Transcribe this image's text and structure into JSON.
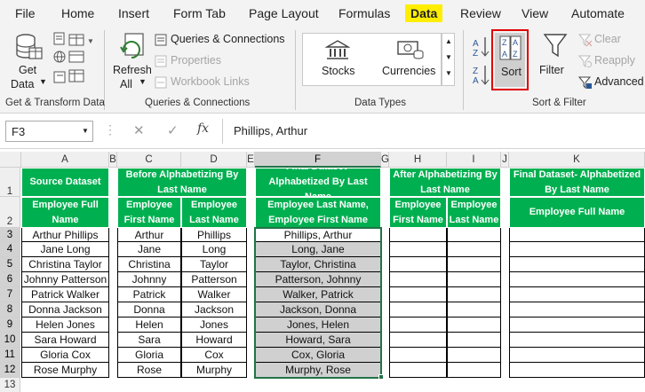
{
  "tabs": [
    "File",
    "Home",
    "Insert",
    "Form Tab",
    "Page Layout",
    "Formulas",
    "Data",
    "Review",
    "View",
    "Automate"
  ],
  "ribbon": {
    "get_data": {
      "line1": "Get",
      "line2": "Data"
    },
    "refresh": {
      "line1": "Refresh",
      "line2": "All"
    },
    "queries_connections": "Queries & Connections",
    "properties": "Properties",
    "workbook_links": "Workbook Links",
    "stocks": "Stocks",
    "currencies": "Currencies",
    "sort": "Sort",
    "filter": "Filter",
    "clear": "Clear",
    "reapply": "Reapply",
    "advanced": "Advanced",
    "groups": [
      "Get & Transform Data",
      "Queries & Connections",
      "Data Types",
      "Sort & Filter"
    ]
  },
  "formula_bar": {
    "name_box": "F3",
    "fx": "fx",
    "content": "Phillips, Arthur"
  },
  "columns": [
    "A",
    "B",
    "C",
    "D",
    "E",
    "F",
    "G",
    "H",
    "I",
    "J",
    "K"
  ],
  "rows": [
    "1",
    "2",
    "3",
    "4",
    "5",
    "6",
    "7",
    "8",
    "9",
    "10",
    "11",
    "12",
    "13"
  ],
  "headers": {
    "source": "Source Dataset",
    "before": "Before Alphabetizing By Last Name",
    "final1": "Final Dataset- Alphabetized By Last Name",
    "after": "After Alphabetizing By Last Name",
    "final2": "Final Dataset- Alphabetized By Last Name",
    "emp_full": "Employee Full Name",
    "emp_first": "Employee First Name",
    "emp_last": "Employee Last Name",
    "emp_last_first": "Employee Last Name, Employee First Name",
    "emp_first2": "Employee First Name",
    "emp_last2": "Employee Last Name",
    "emp_full2": "Employee Full Name"
  },
  "table": {
    "full": [
      "Arthur Phillips",
      "Jane Long",
      "Christina Taylor",
      "Johnny Patterson",
      "Patrick Walker",
      "Donna Jackson",
      "Helen Jones",
      "Sara Howard",
      "Gloria Cox",
      "Rose Murphy"
    ],
    "first": [
      "Arthur",
      "Jane",
      "Christina",
      "Johnny",
      "Patrick",
      "Donna",
      "Helen",
      "Sara",
      "Gloria",
      "Rose"
    ],
    "last": [
      "Phillips",
      "Long",
      "Taylor",
      "Patterson",
      "Walker",
      "Jackson",
      "Jones",
      "Howard",
      "Cox",
      "Murphy"
    ],
    "last_first": [
      "Phillips, Arthur",
      "Long, Jane",
      "Taylor, Christina",
      "Patterson, Johnny",
      "Walker, Patrick",
      "Jackson, Donna",
      "Jones, Helen",
      "Howard, Sara",
      "Cox, Gloria",
      "Murphy, Rose"
    ]
  },
  "colors": {
    "green_header": "#00b050",
    "accent": "#217346",
    "highlight": "#ffee00",
    "sort_outline": "#e00000"
  }
}
